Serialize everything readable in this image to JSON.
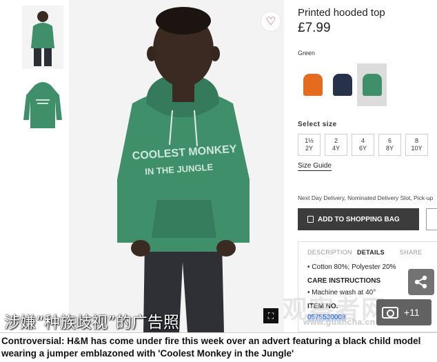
{
  "product": {
    "title": "Printed hooded top",
    "price": "£7.99",
    "color_label": "Green",
    "swatches": [
      {
        "name": "orange-hoodie",
        "color": "#e56b1f"
      },
      {
        "name": "navy-print-hoodie",
        "color": "#27324a"
      },
      {
        "name": "green-hoodie",
        "color": "#3f8f6a",
        "selected": true
      }
    ],
    "size_label": "Select size",
    "sizes": [
      {
        "top": "1½",
        "bottom": "2Y"
      },
      {
        "top": "2",
        "bottom": "4Y"
      },
      {
        "top": "4",
        "bottom": "6Y"
      },
      {
        "top": "6",
        "bottom": "8Y"
      },
      {
        "top": "8",
        "bottom": "10Y"
      }
    ],
    "size_guide": "Size Guide",
    "delivery": "Next Day Delivery, Nominated Delivery Slot, Pick-up",
    "add_to_bag": "ADD TO SHOPPING BAG",
    "tabs": [
      "DESCRIPTION",
      "DETAILS",
      "SHARE"
    ],
    "details": {
      "composition": "• Cotton 80%; Polyester 20%",
      "care_heading": "CARE INSTRUCTIONS",
      "care_line": "• Machine wash at 40°",
      "item_no_label": "ITEM NO.",
      "item_no": "0575530008"
    }
  },
  "image": {
    "hoodie_text_line1": "COOLEST MONKEY",
    "hoodie_text_line2": "IN THE JUNGLE",
    "hoodie_color": "#3f8f6a"
  },
  "overlay": {
    "cn_caption": "涉嫌“种族歧视”的广告照",
    "watermark": "观察者网",
    "watermark_url": "www.guancha.cn",
    "photo_count": "+11"
  },
  "caption": {
    "bold": "Controversial:",
    "text": " H&M has come under fire this week over an advert featuring a black child model wearing a jumper emblazoned with 'Coolest Monkey in the Jungle'"
  }
}
